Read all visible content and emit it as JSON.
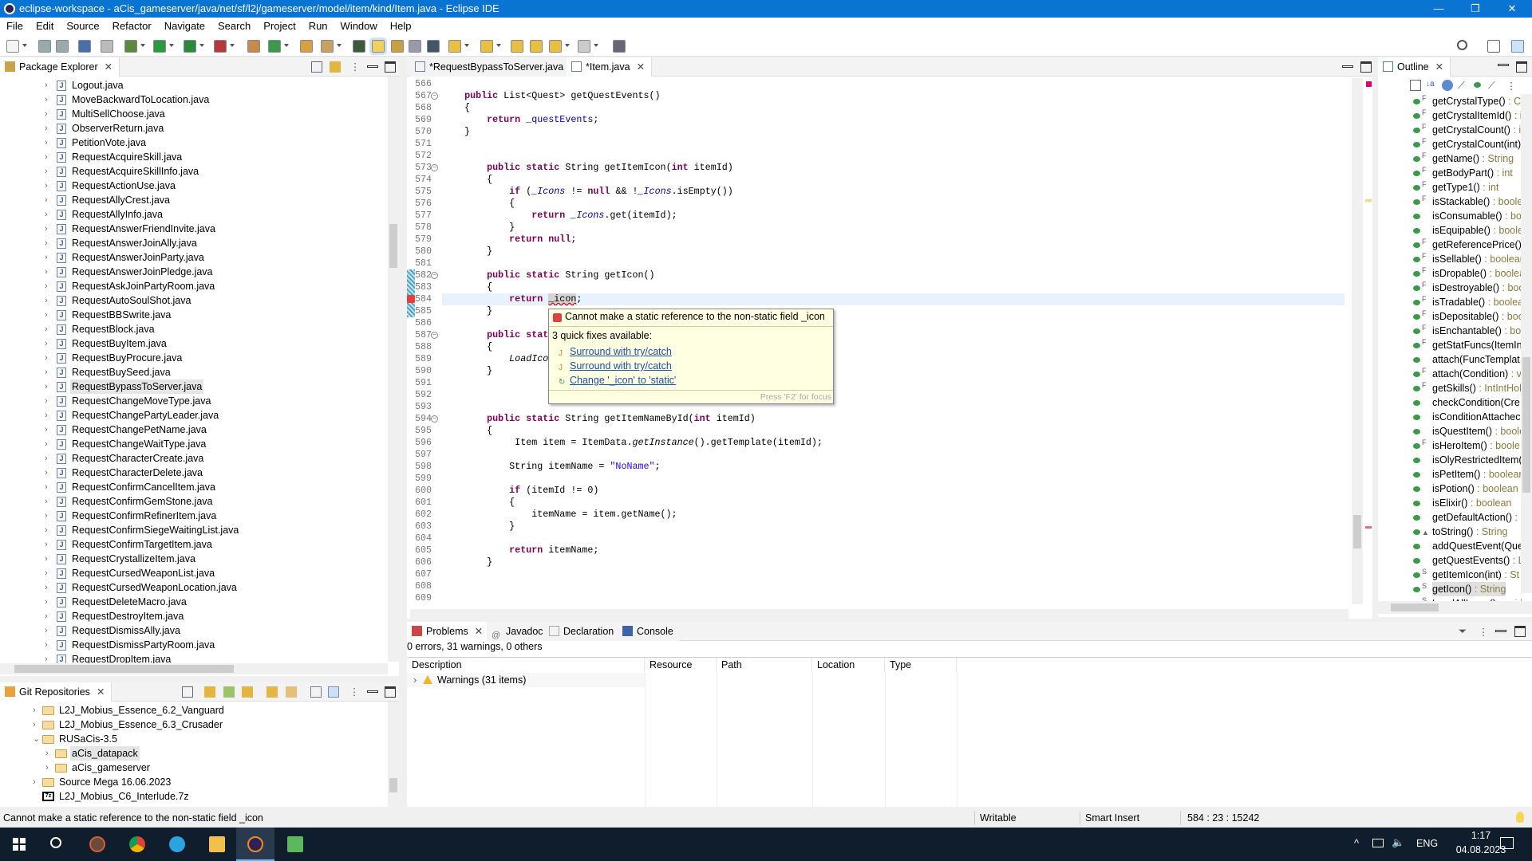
{
  "window": {
    "title": "eclipse-workspace - aCis_gameserver/java/net/sf/l2j/gameserver/model/item/kind/Item.java - Eclipse IDE",
    "minimize": "—",
    "restore": "❐",
    "close": "✕"
  },
  "menu": [
    "File",
    "Edit",
    "Source",
    "Refactor",
    "Navigate",
    "Search",
    "Project",
    "Run",
    "Window",
    "Help"
  ],
  "colors": {
    "titlebar": "#0a74d3",
    "keyword": "#7f0055",
    "field": "#0000c0",
    "string": "#2a00ff",
    "taskbar": "#0f1d2c"
  },
  "package_explorer": {
    "title": "Package Explorer",
    "items": [
      "Logout.java",
      "MoveBackwardToLocation.java",
      "MultiSellChoose.java",
      "ObserverReturn.java",
      "PetitionVote.java",
      "RequestAcquireSkill.java",
      "RequestAcquireSkillInfo.java",
      "RequestActionUse.java",
      "RequestAllyCrest.java",
      "RequestAllyInfo.java",
      "RequestAnswerFriendInvite.java",
      "RequestAnswerJoinAlly.java",
      "RequestAnswerJoinParty.java",
      "RequestAnswerJoinPledge.java",
      "RequestAskJoinPartyRoom.java",
      "RequestAutoSoulShot.java",
      "RequestBBSwrite.java",
      "RequestBlock.java",
      "RequestBuyItem.java",
      "RequestBuyProcure.java",
      "RequestBuySeed.java",
      "RequestBypassToServer.java",
      "RequestChangeMoveType.java",
      "RequestChangePartyLeader.java",
      "RequestChangePetName.java",
      "RequestChangeWaitType.java",
      "RequestCharacterCreate.java",
      "RequestCharacterDelete.java",
      "RequestConfirmCancelItem.java",
      "RequestConfirmGemStone.java",
      "RequestConfirmRefinerItem.java",
      "RequestConfirmSiegeWaitingList.java",
      "RequestConfirmTargetItem.java",
      "RequestCrystallizeItem.java",
      "RequestCursedWeaponList.java",
      "RequestCursedWeaponLocation.java",
      "RequestDeleteMacro.java",
      "RequestDestroyItem.java",
      "RequestDismissAlly.java",
      "RequestDismissPartyRoom.java",
      "RequestDropItem.java"
    ],
    "selected": "RequestBypassToServer.java"
  },
  "git_repositories": {
    "title": "Git Repositories",
    "items": [
      {
        "label": "L2J_Mobius_Essence_6.2_Vanguard",
        "depth": 0,
        "expander": "collapsed",
        "icon": "folder-icon"
      },
      {
        "label": "L2J_Mobius_Essence_6.3_Crusader",
        "depth": 0,
        "expander": "collapsed",
        "icon": "folder-icon"
      },
      {
        "label": "RUSaCis-3.5",
        "depth": 0,
        "expander": "expanded",
        "icon": "folder-icon"
      },
      {
        "label": "aCis_datapack",
        "depth": 1,
        "expander": "collapsed",
        "icon": "folder-icon",
        "selected": true
      },
      {
        "label": "aCis_gameserver",
        "depth": 1,
        "expander": "collapsed",
        "icon": "folder-icon"
      },
      {
        "label": "Source Mega 16.06.2023",
        "depth": 0,
        "expander": "collapsed",
        "icon": "folder-icon"
      },
      {
        "label": "L2J_Mobius_C6_Interlude.7z",
        "depth": 0,
        "expander": "none",
        "icon": "archive-7z-icon"
      }
    ]
  },
  "editor": {
    "tabs": [
      {
        "label": "*RequestBypassToServer.java",
        "active": false
      },
      {
        "label": "*Item.java",
        "active": true
      }
    ],
    "current_line": 584,
    "lines": [
      {
        "n": 566,
        "t": []
      },
      {
        "n": 567,
        "fold": true,
        "t": [
          [
            "    ",
            "p"
          ],
          [
            "public",
            "k"
          ],
          [
            " List<Quest> getQuestEvents()",
            "p"
          ]
        ]
      },
      {
        "n": 568,
        "t": [
          [
            "    {",
            "p"
          ]
        ]
      },
      {
        "n": 569,
        "t": [
          [
            "        ",
            "p"
          ],
          [
            "return",
            "k"
          ],
          [
            " ",
            "p"
          ],
          [
            "_questEvents",
            "f"
          ],
          [
            ";",
            "p"
          ]
        ]
      },
      {
        "n": 570,
        "t": [
          [
            "    }",
            "p"
          ]
        ]
      },
      {
        "n": 571,
        "t": []
      },
      {
        "n": 572,
        "t": []
      },
      {
        "n": 573,
        "fold": true,
        "t": [
          [
            "        ",
            "p"
          ],
          [
            "public",
            "k"
          ],
          [
            " ",
            "p"
          ],
          [
            "static",
            "k"
          ],
          [
            " String getItemIcon(",
            "p"
          ],
          [
            "int",
            "k"
          ],
          [
            " itemId)",
            "p"
          ]
        ]
      },
      {
        "n": 574,
        "t": [
          [
            "        {",
            "p"
          ]
        ]
      },
      {
        "n": 575,
        "t": [
          [
            "            ",
            "p"
          ],
          [
            "if",
            "k"
          ],
          [
            " (",
            "p"
          ],
          [
            "_Icons",
            "sf"
          ],
          [
            " != ",
            "p"
          ],
          [
            "null",
            "k"
          ],
          [
            " && !",
            "p"
          ],
          [
            "_Icons",
            "sf"
          ],
          [
            ".isEmpty())",
            "p"
          ]
        ]
      },
      {
        "n": 576,
        "t": [
          [
            "            {",
            "p"
          ]
        ]
      },
      {
        "n": 577,
        "t": [
          [
            "                ",
            "p"
          ],
          [
            "return",
            "k"
          ],
          [
            " ",
            "p"
          ],
          [
            "_Icons",
            "sf"
          ],
          [
            ".get(itemId);",
            "p"
          ]
        ]
      },
      {
        "n": 578,
        "t": [
          [
            "            }",
            "p"
          ]
        ]
      },
      {
        "n": 579,
        "t": [
          [
            "            ",
            "p"
          ],
          [
            "return",
            "k"
          ],
          [
            " ",
            "p"
          ],
          [
            "null",
            "k"
          ],
          [
            ";",
            "p"
          ]
        ]
      },
      {
        "n": 580,
        "t": [
          [
            "        }",
            "p"
          ]
        ]
      },
      {
        "n": 581,
        "t": []
      },
      {
        "n": 582,
        "fold": true,
        "t": [
          [
            "        ",
            "p"
          ],
          [
            "public",
            "k"
          ],
          [
            " ",
            "p"
          ],
          [
            "static",
            "k"
          ],
          [
            " String getIcon()",
            "p"
          ]
        ]
      },
      {
        "n": 583,
        "t": [
          [
            "        {",
            "p"
          ]
        ]
      },
      {
        "n": 584,
        "error": true,
        "t": [
          [
            "            ",
            "p"
          ],
          [
            "return",
            "k"
          ],
          [
            " ",
            "p"
          ],
          [
            "_icon",
            "err"
          ],
          [
            ";",
            "p"
          ]
        ]
      },
      {
        "n": 585,
        "t": [
          [
            "        }",
            "p"
          ]
        ]
      },
      {
        "n": 586,
        "t": []
      },
      {
        "n": 587,
        "fold": true,
        "t": [
          [
            "        ",
            "p"
          ],
          [
            "public",
            "k"
          ],
          [
            " ",
            "p"
          ],
          [
            "stat",
            "k"
          ]
        ]
      },
      {
        "n": 588,
        "t": [
          [
            "        {",
            "p"
          ]
        ]
      },
      {
        "n": 589,
        "t": [
          [
            "            ",
            "p"
          ],
          [
            "LoadIco",
            "sm"
          ]
        ]
      },
      {
        "n": 590,
        "t": [
          [
            "        }",
            "p"
          ]
        ]
      },
      {
        "n": 591,
        "t": []
      },
      {
        "n": 592,
        "t": []
      },
      {
        "n": 593,
        "t": []
      },
      {
        "n": 594,
        "fold": true,
        "t": [
          [
            "        ",
            "p"
          ],
          [
            "public",
            "k"
          ],
          [
            " ",
            "p"
          ],
          [
            "static",
            "k"
          ],
          [
            " String getItemNameById(",
            "p"
          ],
          [
            "int",
            "k"
          ],
          [
            " itemId)",
            "p"
          ]
        ]
      },
      {
        "n": 595,
        "t": [
          [
            "        {",
            "p"
          ]
        ]
      },
      {
        "n": 596,
        "t": [
          [
            "             Item item = ItemData.",
            "p"
          ],
          [
            "getInstance",
            "sm"
          ],
          [
            "().getTemplate(itemId);",
            "p"
          ]
        ]
      },
      {
        "n": 597,
        "t": []
      },
      {
        "n": 598,
        "t": [
          [
            "            String itemName = ",
            "p"
          ],
          [
            "\"NoName\"",
            "s"
          ],
          [
            ";",
            "p"
          ]
        ]
      },
      {
        "n": 599,
        "t": []
      },
      {
        "n": 600,
        "t": [
          [
            "            ",
            "p"
          ],
          [
            "if",
            "k"
          ],
          [
            " (itemId != 0)",
            "p"
          ]
        ]
      },
      {
        "n": 601,
        "t": [
          [
            "            {",
            "p"
          ]
        ]
      },
      {
        "n": 602,
        "t": [
          [
            "                itemName = item.getName();",
            "p"
          ]
        ]
      },
      {
        "n": 603,
        "t": [
          [
            "            }",
            "p"
          ]
        ]
      },
      {
        "n": 604,
        "t": []
      },
      {
        "n": 605,
        "t": [
          [
            "            ",
            "p"
          ],
          [
            "return",
            "k"
          ],
          [
            " itemName;",
            "p"
          ]
        ]
      },
      {
        "n": 606,
        "t": [
          [
            "        }",
            "p"
          ]
        ]
      },
      {
        "n": 607,
        "t": []
      },
      {
        "n": 608,
        "t": []
      },
      {
        "n": 609,
        "t": []
      }
    ]
  },
  "hover": {
    "message": "Cannot make a static reference to the non-static field _icon",
    "count_label": "3 quick fixes available:",
    "fixes": [
      "Surround with try/catch",
      "Surround with try/catch",
      "Change '_icon' to 'static'"
    ],
    "footer": "Press 'F2' for focus"
  },
  "outline": {
    "title": "Outline",
    "items": [
      {
        "m": "F",
        "n": "getCrystalType()",
        "t": " : Cr"
      },
      {
        "m": "F",
        "n": "getCrystalItemId()",
        "t": " : i"
      },
      {
        "m": "F",
        "n": "getCrystalCount()",
        "t": " : i"
      },
      {
        "m": "F",
        "n": "getCrystalCount(int)",
        "t": ""
      },
      {
        "m": "F",
        "n": "getName()",
        "t": " : String"
      },
      {
        "m": "F",
        "n": "getBodyPart()",
        "t": " : int"
      },
      {
        "m": "F",
        "n": "getType1()",
        "t": " : int"
      },
      {
        "m": "F",
        "n": "isStackable()",
        "t": " : boole"
      },
      {
        "m": "",
        "n": "isConsumable()",
        "t": " : bo"
      },
      {
        "m": "",
        "n": "isEquipable()",
        "t": " : boole"
      },
      {
        "m": "F",
        "n": "getReferencePrice()",
        "t": ""
      },
      {
        "m": "F",
        "n": "isSellable()",
        "t": " : boolean"
      },
      {
        "m": "F",
        "n": "isDropable()",
        "t": " : boolea"
      },
      {
        "m": "F",
        "n": "isDestroyable()",
        "t": " : boo"
      },
      {
        "m": "F",
        "n": "isTradable()",
        "t": " : boolea"
      },
      {
        "m": "F",
        "n": "isDepositable()",
        "t": " : boo"
      },
      {
        "m": "F",
        "n": "isEnchantable()",
        "t": " : boo"
      },
      {
        "m": "F",
        "n": "getStatFuncs(ItemIn",
        "t": ""
      },
      {
        "m": "",
        "n": "attach(FuncTemplat",
        "t": ""
      },
      {
        "m": "F",
        "n": "attach(Condition)",
        "t": " : v"
      },
      {
        "m": "F",
        "n": "getSkills()",
        "t": " : IntIntHol"
      },
      {
        "m": "",
        "n": "checkCondition(Cre",
        "t": ""
      },
      {
        "m": "",
        "n": "isConditionAttachec",
        "t": ""
      },
      {
        "m": "",
        "n": "isQuestItem()",
        "t": " : boole"
      },
      {
        "m": "F",
        "n": "isHeroItem()",
        "t": " : boole"
      },
      {
        "m": "",
        "n": "isOlyRestrictedItem(",
        "t": ""
      },
      {
        "m": "",
        "n": "isPetItem()",
        "t": " : boolean"
      },
      {
        "m": "",
        "n": "isPotion()",
        "t": " : boolean"
      },
      {
        "m": "",
        "n": "isElixir()",
        "t": " : boolean"
      },
      {
        "m": "",
        "n": "getDefaultAction()",
        "t": " :"
      },
      {
        "m": "▲",
        "n": "toString()",
        "t": " : String"
      },
      {
        "m": "",
        "n": "addQuestEvent(Que",
        "t": ""
      },
      {
        "m": "",
        "n": "getQuestEvents()",
        "t": " : L"
      },
      {
        "m": "S",
        "n": "getItemIcon(int)",
        "t": " : St"
      },
      {
        "m": "S",
        "n": "getIcon()",
        "t": " : String",
        "selected": true
      },
      {
        "m": "S",
        "n": "LoadAllIcons()",
        "t": " : void"
      }
    ]
  },
  "problems": {
    "tabs": [
      "Problems",
      "Javadoc",
      "Declaration",
      "Console"
    ],
    "summary": "0 errors, 31 warnings, 0 others",
    "columns": [
      "Description",
      "Resource",
      "Path",
      "Location",
      "Type"
    ],
    "rows": [
      {
        "label": "Warnings (31 items)"
      }
    ]
  },
  "status": {
    "message": "Cannot make a static reference to the non-static field _icon",
    "writable": "Writable",
    "insert_mode": "Smart Insert",
    "position": "584 : 23 : 15242"
  },
  "taskbar": {
    "language": "ENG",
    "time": "1:17",
    "date": "04.08.2023",
    "apps": [
      "start-icon",
      "search-icon",
      "app-icon",
      "chrome-icon",
      "telegram-icon",
      "file-explorer-icon",
      "eclipse-icon",
      "notepad-icon"
    ]
  }
}
